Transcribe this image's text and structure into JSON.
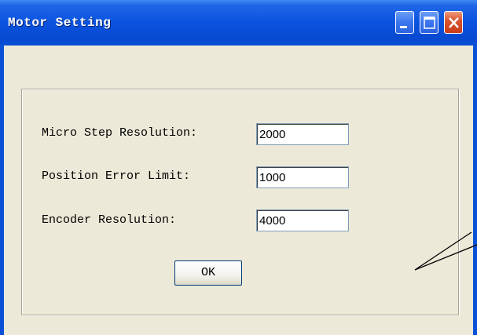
{
  "window": {
    "title": "Motor Setting",
    "title_first_letter": "M",
    "title_rest": "otor Setting"
  },
  "form": {
    "micro_step": {
      "label": "Micro Step Resolution:",
      "value": "2000"
    },
    "position_error": {
      "label": "Position Error Limit:",
      "value": "1000"
    },
    "encoder": {
      "label": "Encoder Resolution:",
      "value": "4000"
    }
  },
  "buttons": {
    "ok_label": "OK"
  },
  "icons": {
    "minimize": "minimize-icon",
    "maximize": "maximize-icon",
    "close": "close-icon"
  },
  "colors": {
    "titlebar": "#0a53df",
    "client_bg": "#ece9d8",
    "close_button": "#d9532b"
  }
}
